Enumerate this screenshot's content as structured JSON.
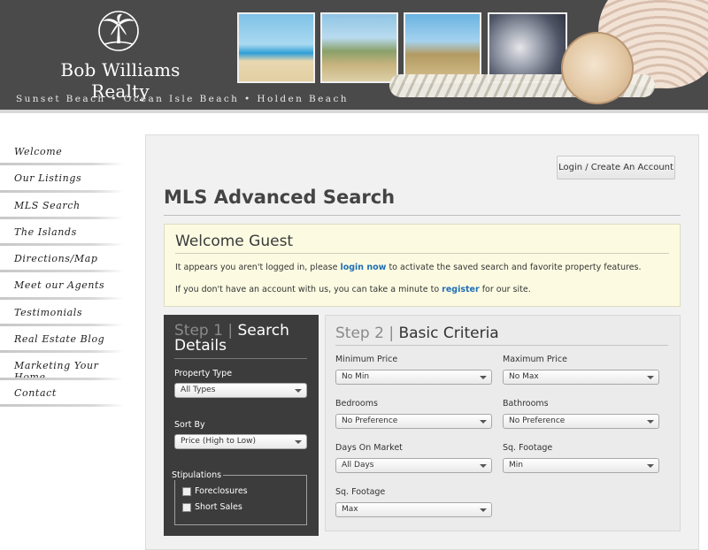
{
  "header": {
    "logo_text": "Bob Williams Realty",
    "tagline": "Sunset Beach • Ocean Isle Beach • Holden Beach"
  },
  "sidebar": {
    "items": [
      {
        "label": "Welcome"
      },
      {
        "label": "Our Listings"
      },
      {
        "label": "MLS Search"
      },
      {
        "label": "The Islands"
      },
      {
        "label": "Directions/Map"
      },
      {
        "label": "Meet our Agents"
      },
      {
        "label": "Testimonials"
      },
      {
        "label": "Real Estate Blog"
      },
      {
        "label": "Marketing Your Home"
      },
      {
        "label": "Contact"
      }
    ]
  },
  "main": {
    "login_button": "Login / Create An Account",
    "page_title": "MLS Advanced Search",
    "welcome": {
      "title": "Welcome Guest",
      "line1_pre": "It appears you aren't logged in, please ",
      "line1_link": "login now",
      "line1_post": " to activate the saved search and favorite property features.",
      "line2_pre": "If you don't have an account with us, you can take a minute to ",
      "line2_link": "register",
      "line2_post": " for our site."
    },
    "step1": {
      "num": "Step 1 | ",
      "title": "Search Details",
      "property_type_label": "Property Type",
      "property_type_value": "All Types",
      "sort_by_label": "Sort By",
      "sort_by_value": "Price (High to Low)",
      "stipulations_label": "Stipulations",
      "stipulations": [
        {
          "label": "Foreclosures",
          "checked": false
        },
        {
          "label": "Short Sales",
          "checked": false
        }
      ]
    },
    "step2": {
      "num": "Step 2 | ",
      "title": "Basic Criteria",
      "fields": [
        {
          "label": "Minimum Price",
          "value": "No Min"
        },
        {
          "label": "Maximum Price",
          "value": "No Max"
        },
        {
          "label": "Bedrooms",
          "value": "No Preference"
        },
        {
          "label": "Bathrooms",
          "value": "No Preference"
        },
        {
          "label": "Days On Market",
          "value": "All Days"
        },
        {
          "label": "Sq. Footage",
          "value": "Min"
        },
        {
          "label": "Sq. Footage",
          "value": "Max"
        }
      ]
    }
  },
  "colors": {
    "header_bg": "#4a4a4a",
    "link": "#1f6fb5",
    "step1_bg": "#3c3c3c",
    "welcome_bg": "#fcfbe2"
  }
}
